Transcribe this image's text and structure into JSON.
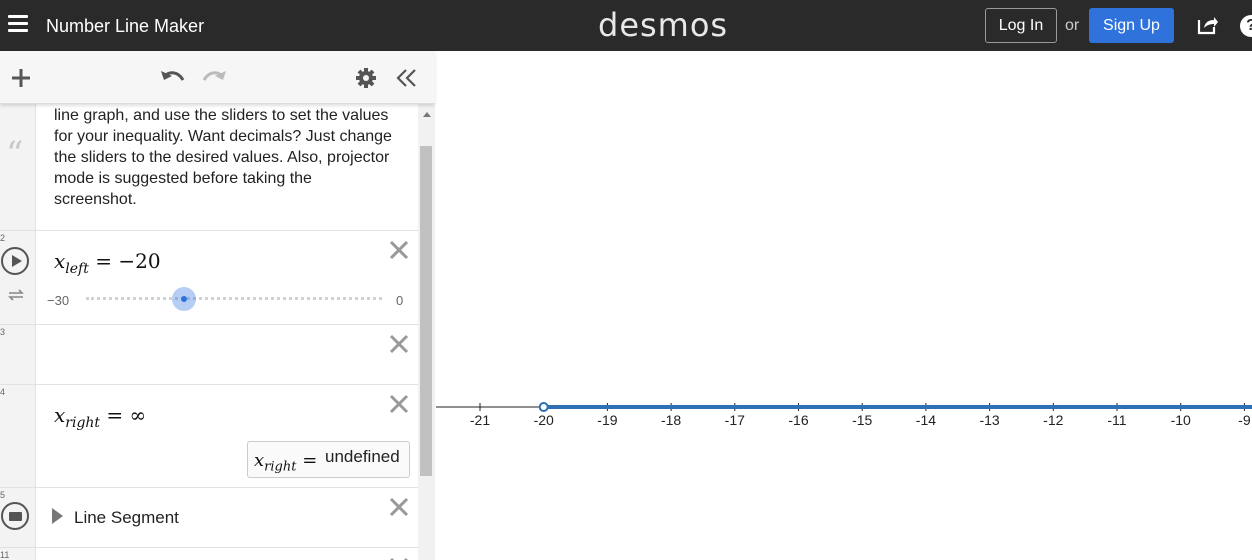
{
  "header": {
    "app_title": "Number Line Maker",
    "logo": "desmos",
    "login_label": "Log In",
    "or_label": "or",
    "signup_label": "Sign Up",
    "help_label": "?"
  },
  "toolbar": {
    "add_icon": "plus-icon",
    "undo_icon": "undo-icon",
    "redo_icon": "redo-icon",
    "settings_icon": "gear-icon",
    "collapse_icon": "double-chevron-left-icon"
  },
  "expressions": {
    "note": {
      "text": "line graph, and use the sliders to set the values for your inequality. Want decimals? Just change the sliders to the desired values. Also, projector mode is suggested before taking the screenshot."
    },
    "xleft": {
      "number": "2",
      "var": "x",
      "sub": "left",
      "op": "=",
      "value": "−20",
      "slider_min": "−30",
      "slider_max": "0",
      "slider_fraction": 0.333
    },
    "empty": {
      "number": "3"
    },
    "xright": {
      "number": "4",
      "var": "x",
      "sub": "right",
      "op": "=",
      "value": "∞",
      "eval_var": "x",
      "eval_sub": "right",
      "eval_op": "=",
      "eval_value": "undefined"
    },
    "folder": {
      "number": "5",
      "label": "Line Segment"
    },
    "last": {
      "number": "11"
    }
  },
  "graph": {
    "ticks": [
      "-21",
      "-20",
      "-19",
      "-18",
      "-17",
      "-16",
      "-15",
      "-14",
      "-13",
      "-12",
      "-11",
      "-10",
      "-9"
    ],
    "ray_start": -20,
    "ray_color": "#2d70b3"
  }
}
